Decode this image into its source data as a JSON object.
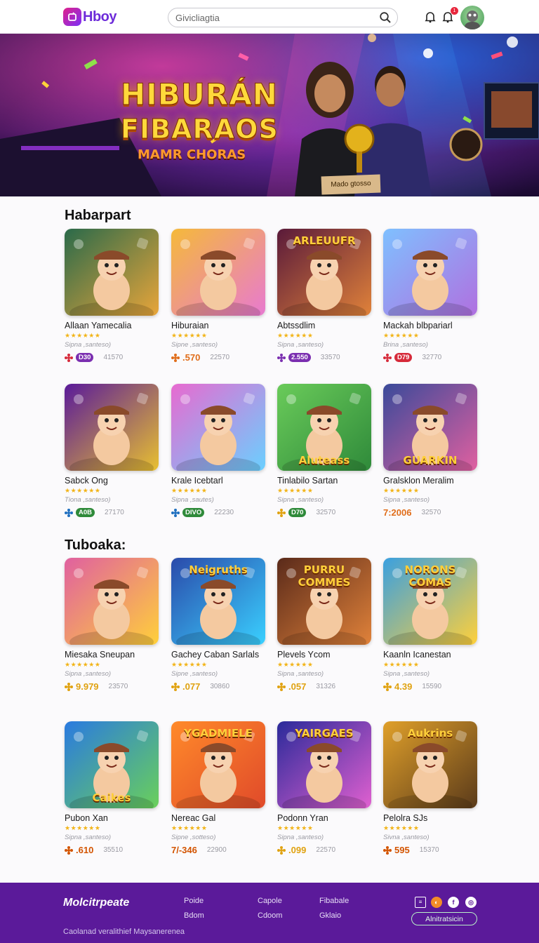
{
  "header": {
    "logo_text": "Hboy",
    "search_value": "Givicliagtia",
    "notif_count": "1"
  },
  "hero": {
    "title_line1": "HIBURÁN",
    "title_line2": "FIBARAOS",
    "subtitle": "MAMR CHORAS",
    "sign_text": "Mado gtosso"
  },
  "sections": [
    {
      "title": "Habarpart",
      "rows": [
        [
          {
            "title": "Allaan Yamecalia",
            "sub": "Sipna ,santeso)",
            "badge": "D30",
            "badge_color": "#7b2fb0",
            "icon": "red-flower-icon",
            "icon_color": "#d62a3a",
            "count": "41570",
            "caption": ""
          },
          {
            "title": "Hiburaian",
            "sub": "Sipne ,santeso)",
            "price": ".570",
            "icon": "orange-flower-icon",
            "icon_color": "#e06d1a",
            "count": "22570",
            "caption": ""
          },
          {
            "title": "Abtssdlim",
            "sub": "Sipna ,santeso)",
            "badge": "2.550",
            "badge_color": "#7b2fb0",
            "icon": "purple-flower-icon",
            "icon_color": "#7b2fb0",
            "count": "33570",
            "caption": "ARLEUUFR"
          },
          {
            "title": "Mackah blbpariarl",
            "sub": "Brina ,santeso)",
            "badge": "D79",
            "badge_color": "#d62a3a",
            "icon": "red-flower-icon",
            "icon_color": "#d62a3a",
            "count": "32770",
            "caption": ""
          }
        ],
        [
          {
            "title": "Sabck Ong",
            "sub": "Tiona ,santeso)",
            "badge": "A0B",
            "badge_color": "#2f8a3a",
            "icon": "blue-circle-icon",
            "icon_color": "#1f6fbf",
            "count": "27170",
            "caption": ""
          },
          {
            "title": "Krale Icebtarl",
            "sub": "Sipna ,sautes)",
            "badge": "DIVO",
            "badge_color": "#2f8a3a",
            "icon": "blue-flower-icon",
            "icon_color": "#1f6fbf",
            "count": "22230",
            "caption": ""
          },
          {
            "title": "Tinlabilo Sartan",
            "sub": "Sipna ,santeso)",
            "badge": "D70",
            "badge_color": "#2f8a3a",
            "icon": "yellow-flower-icon",
            "icon_color": "#e0a210",
            "count": "32570",
            "caption": "Aluteass"
          },
          {
            "title": "Gralsklon Meralim",
            "sub": "Sipna ,santeso)",
            "price": "7:2006",
            "icon": "",
            "icon_color": "#e06d1a",
            "count": "32570",
            "caption": "GUARKIN"
          }
        ]
      ]
    },
    {
      "title": "Tuboaka:",
      "rows": [
        [
          {
            "title": "Miesaka Sneupan",
            "sub": "Sipna ,santeso)",
            "price": "9.979",
            "icon": "orange-flower-icon",
            "icon_color": "#e0a210",
            "count": "23570",
            "caption": ""
          },
          {
            "title": "Gachey Caban Sarlals",
            "sub": "Sipne ,santeso)",
            "price": ".077",
            "icon": "yellow-circle-icon",
            "icon_color": "#e0a210",
            "count": "30860",
            "caption": "Neigruths"
          },
          {
            "title": "Plevels Ycom",
            "sub": "Sipna ,santeso)",
            "price": ".057",
            "icon": "orange-flower-icon",
            "icon_color": "#e0a210",
            "count": "31326",
            "caption": "PURRU COMMES"
          },
          {
            "title": "Kaanln Icanestan",
            "sub": "Sipna ,santeso)",
            "price": "4.39",
            "icon": "orange-flower-icon",
            "icon_color": "#e0a210",
            "count": "15590",
            "caption": "NORONS COMAS"
          }
        ],
        [
          {
            "title": "Pubon Xan",
            "sub": "Sipna ,santeso)",
            "price": ".610",
            "icon": "orange-flower-icon",
            "icon_color": "#d35400",
            "count": "35510",
            "caption": "Caikes"
          },
          {
            "title": "Nereac Gal",
            "sub": "Sipne ,sotteso)",
            "price": "7/-346",
            "icon": "",
            "icon_color": "#d35400",
            "count": "22900",
            "caption": "YGADMIELE"
          },
          {
            "title": "Podonn Yran",
            "sub": "Sipna ,santeso)",
            "price": ".099",
            "icon": "orange-flower-icon",
            "icon_color": "#e0a210",
            "count": "22570",
            "caption": "YAIRGAES"
          },
          {
            "title": "Pelolra SJs",
            "sub": "Sivna ,santeso)",
            "price": "595",
            "icon": "orange-flower-icon",
            "icon_color": "#d35400",
            "count": "15370",
            "caption": "Aukrins"
          }
        ]
      ]
    }
  ],
  "footer": {
    "brand": "Molcitrpeate",
    "links": [
      "Poide",
      "Capole",
      "Fibabale",
      "Bdom",
      "Cdoom",
      "Gklaio"
    ],
    "copyright": "Caolanad veralithief Maysanerenea",
    "button_label": "Alnitratsicin"
  },
  "stars": "★★★★★★"
}
